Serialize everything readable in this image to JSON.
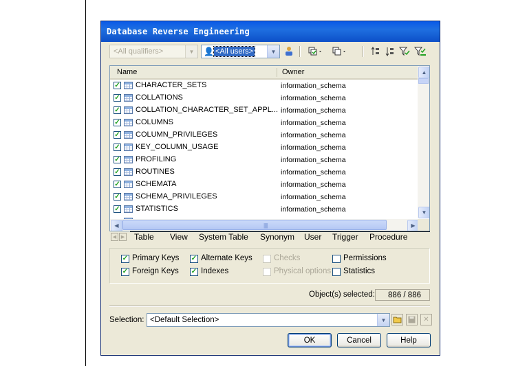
{
  "dialog": {
    "title": "Database Reverse Engineering"
  },
  "toolbar": {
    "qualifiers_placeholder": "<All qualifiers>",
    "users_value": "<All users>",
    "icons": [
      "user-properties-icon",
      "select-all-icon",
      "deselect-all-icon",
      "move-up-icon",
      "move-down-icon",
      "filter-icon",
      "clear-filter-icon"
    ]
  },
  "list": {
    "columns": [
      "Name",
      "Owner"
    ],
    "rows": [
      {
        "name": "CHARACTER_SETS",
        "owner": "information_schema",
        "checked": true
      },
      {
        "name": "COLLATIONS",
        "owner": "information_schema",
        "checked": true
      },
      {
        "name": "COLLATION_CHARACTER_SET_APPL...",
        "owner": "information_schema",
        "checked": true
      },
      {
        "name": "COLUMNS",
        "owner": "information_schema",
        "checked": true
      },
      {
        "name": "COLUMN_PRIVILEGES",
        "owner": "information_schema",
        "checked": true
      },
      {
        "name": "KEY_COLUMN_USAGE",
        "owner": "information_schema",
        "checked": true
      },
      {
        "name": "PROFILING",
        "owner": "information_schema",
        "checked": true
      },
      {
        "name": "ROUTINES",
        "owner": "information_schema",
        "checked": true
      },
      {
        "name": "SCHEMATA",
        "owner": "information_schema",
        "checked": true
      },
      {
        "name": "SCHEMA_PRIVILEGES",
        "owner": "information_schema",
        "checked": true
      },
      {
        "name": "STATISTICS",
        "owner": "information_schema",
        "checked": true
      }
    ]
  },
  "tabs": [
    "Table",
    "View",
    "System Table",
    "Synonym",
    "User",
    "Trigger",
    "Procedure"
  ],
  "options": {
    "primary_keys": {
      "label": "Primary Keys",
      "checked": true
    },
    "foreign_keys": {
      "label": "Foreign Keys",
      "checked": true
    },
    "alternate_keys": {
      "label": "Alternate Keys",
      "checked": true
    },
    "indexes": {
      "label": "Indexes",
      "checked": true
    },
    "checks": {
      "label": "Checks",
      "checked": false
    },
    "physical_options": {
      "label": "Physical options",
      "checked": false
    },
    "permissions": {
      "label": "Permissions",
      "checked": false
    },
    "statistics": {
      "label": "Statistics",
      "checked": false
    }
  },
  "status": {
    "objects_selected_label": "Object(s) selected:",
    "objects_selected_value": "886 / 886"
  },
  "selection": {
    "label": "Selection:",
    "value": "<Default Selection>"
  },
  "buttons": {
    "ok": "OK",
    "cancel": "Cancel",
    "help": "Help"
  },
  "colors": {
    "titlebar": "#0a5ae8",
    "dialog_bg": "#ece9d8",
    "selection_highlight": "#316ac5"
  }
}
